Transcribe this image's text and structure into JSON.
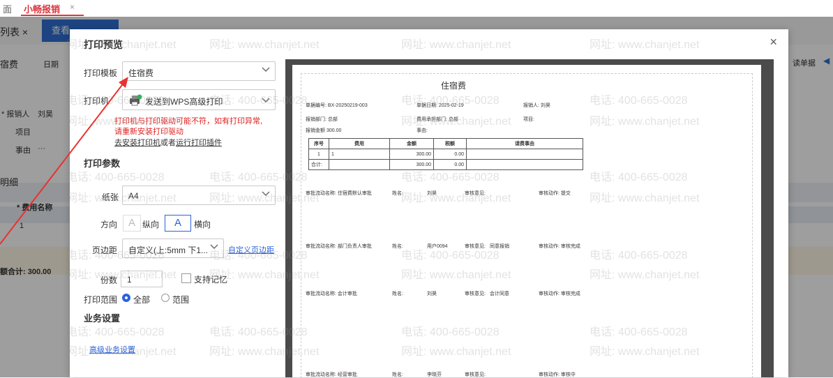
{
  "tabbar": {
    "home": "面",
    "active": "小畅报销",
    "close": "×"
  },
  "background": {
    "list_tab": "列表 ×",
    "view_button": "查看",
    "type": "宿费",
    "date_label": "日期",
    "reporter_label": "* 报销人",
    "reporter_value": "刘昊",
    "project_label": "项目",
    "matter_label": "事由",
    "matter_value": "···",
    "detail_title": "明细",
    "fee_name_header": "* 费用名称",
    "row_no": "1",
    "total": "额合计: 300.00",
    "right_text": "读单据"
  },
  "dialog": {
    "title": "打印预览",
    "close": "×",
    "template_label": "打印模板",
    "template_value": "住宿费",
    "printer_label": "打印机",
    "printer_value": "发送到WPS高级打印",
    "warning_line1": "打印机与打印驱动可能不符，如有打印异常,",
    "warning_line2": "请重新安装打印驱动",
    "install_link": "去安装打印机",
    "or_text": "或者",
    "plugin_link": "运行打印插件",
    "params_title": "打印参数",
    "paper_label": "纸张",
    "paper_value": "A4",
    "orient_label": "方向",
    "portrait": "纵向",
    "landscape": "横向",
    "orient_glyph": "A",
    "margin_label": "页边距",
    "margin_value": "自定义(上:5mm  下1...",
    "margin_link": "自定义页边距",
    "copies_label": "份数",
    "copies_value": "1",
    "remember": "支持记忆",
    "range_label": "打印范围",
    "range_all": "全部",
    "range_custom": "范围",
    "business_title": "业务设置",
    "advanced_link": "高级业务设置"
  },
  "preview": {
    "title": "住宿费",
    "doc_no": "单据编号: BX-20250219-003",
    "doc_date": "单据日期: 2025-02-19",
    "reporter": "报销人: 刘昊",
    "dept": "报销部门: 总部",
    "cost_dept": "费用承担部门: 总部",
    "project": "项目:",
    "amount": "报销金额 300.00",
    "matter": "事由:",
    "table_headers": [
      "序号",
      "费用",
      "金额",
      "税额",
      "请费事由"
    ],
    "row1": [
      "1",
      "1",
      "300.00",
      "0.00",
      ""
    ],
    "row2": [
      "合计:",
      "",
      "300.00",
      "0.00",
      ""
    ],
    "approvals": [
      {
        "node": "审批流动名称: 住宿费默认审批",
        "name_label": "姓名:",
        "name": "刘昊",
        "opinion_label": "审核意见:",
        "opinion": "",
        "action": "审核动作:  提交"
      },
      {
        "node": "审批流动名称: 部门负责人审批",
        "name_label": "姓名:",
        "name": "用户0094",
        "opinion_label": "审核意见:",
        "opinion": "同意报销",
        "action": "审核动作:  审核完成"
      },
      {
        "node": "审批流动名称: 会计审批",
        "name_label": "姓名:",
        "name": "刘昊",
        "opinion_label": "审核意见:",
        "opinion": "会计同意",
        "action": "审核动作:  审核完成"
      },
      {
        "node": "审批流动名称: 经营审批",
        "name_label": "姓名:",
        "name": "李晓芬",
        "opinion_label": "审核意见:",
        "opinion": "",
        "action": "审核动作:  审核中"
      }
    ]
  },
  "watermark": {
    "phone": "电话: 400-665-0028",
    "site": "网址: www.chanjet.net"
  },
  "colors": {
    "accent": "#2b63d9",
    "warning": "#e02020",
    "tab_active": "#d9363e"
  }
}
